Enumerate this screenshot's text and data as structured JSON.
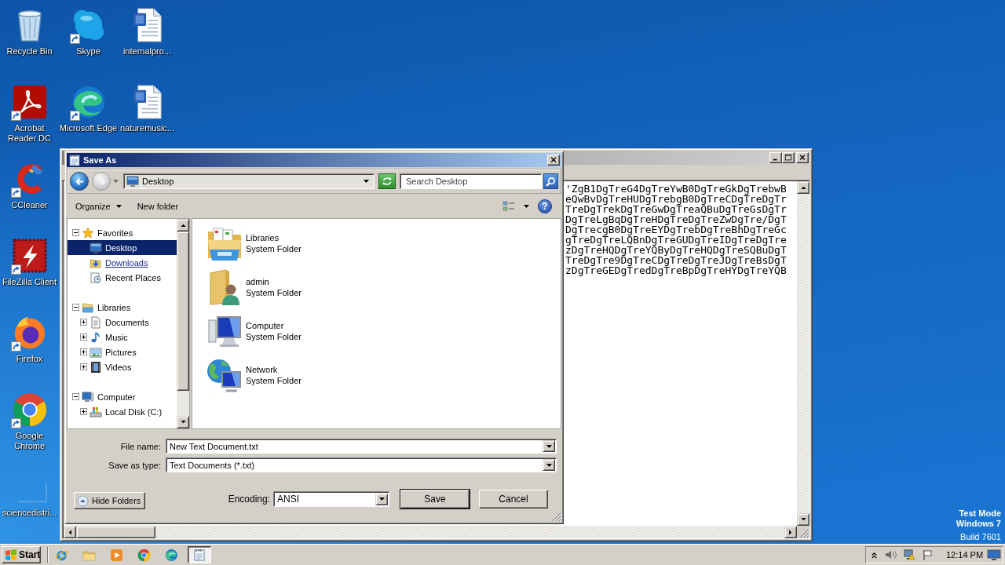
{
  "desktop_icon_columns": [
    [
      {
        "label": "Recycle Bin",
        "kind": "bin",
        "shortcut": false
      },
      {
        "label": "Acrobat Reader DC",
        "kind": "pdf",
        "shortcut": true
      },
      {
        "label": "CCleaner",
        "kind": "cleaner",
        "shortcut": true
      },
      {
        "label": "FileZilla Client",
        "kind": "ftp",
        "shortcut": true
      },
      {
        "label": "Firefox",
        "kind": "firefox",
        "shortcut": true
      },
      {
        "label": "Google Chrome",
        "kind": "chrome",
        "shortcut": true
      },
      {
        "label": "sciencedistri...",
        "kind": "blank",
        "shortcut": false
      }
    ],
    [
      {
        "label": "Skype",
        "kind": "chat",
        "shortcut": true
      },
      {
        "label": "Microsoft Edge",
        "kind": "edge",
        "shortcut": true
      }
    ],
    [
      {
        "label": "internalpro...",
        "kind": "doc",
        "shortcut": false
      },
      {
        "label": "naturemusic...",
        "kind": "doc",
        "shortcut": false
      }
    ]
  ],
  "notepad": {
    "text_lines": [
      "'ZgB1DgTreG4DgTreYwB0DgTreGkDgTrebwB",
      "eQwBvDgTreHUDgTrebgB0DgTreCDgTreDgTr",
      "TreDgTrekDgTreGwDgTreaQBuDgTreGsDgTr",
      "DgTreLgBqDgTreHDgTreDgTreZwDgTre/DgT",
      "DgTrecgB0DgTreEYDgTrebDgTreBhDgTreGc",
      "gTreDgTreLQBnDgTreGUDgTreIDgTreDgTre",
      "zDgTreHQDgTreYQByDgTreHQDgTreSQBuDgT",
      "TreDgTre9DgTreCDgTreDgTreJDgTreBsDgT",
      "zDgTreGEDgTredDgTreBpDgTreHYDgTreYQB"
    ]
  },
  "save_dialog": {
    "title": "Save As",
    "address": "Desktop",
    "search": {
      "placeholder": "Search Desktop"
    },
    "commands": {
      "organize": "Organize",
      "new_folder": "New folder",
      "help": "?"
    },
    "tree": [
      {
        "label": "Favorites",
        "kind": "favorites",
        "expanded": true,
        "selected": false,
        "hovered": false,
        "children": [
          {
            "label": "Desktop",
            "kind": "desktop",
            "selected": true,
            "hovered": false
          },
          {
            "label": "Downloads",
            "kind": "downloads",
            "selected": false,
            "hovered": true
          },
          {
            "label": "Recent Places",
            "kind": "recent",
            "selected": false,
            "hovered": false
          }
        ]
      },
      {
        "label": "Libraries",
        "kind": "libraries",
        "expanded": true,
        "selected": false,
        "hovered": false,
        "children": [
          {
            "label": "Documents",
            "kind": "documents",
            "expanded": false,
            "selected": false,
            "hovered": false
          },
          {
            "label": "Music",
            "kind": "music",
            "expanded": false,
            "selected": false,
            "hovered": false
          },
          {
            "label": "Pictures",
            "kind": "pictures",
            "expanded": false,
            "selected": false,
            "hovered": false
          },
          {
            "label": "Videos",
            "kind": "videos",
            "expanded": false,
            "selected": false,
            "hovered": false
          }
        ]
      },
      {
        "label": "Computer",
        "kind": "computer",
        "expanded": true,
        "selected": false,
        "hovered": false,
        "children": [
          {
            "label": "Local Disk (C:)",
            "kind": "disk",
            "expanded": false,
            "selected": false,
            "hovered": false
          }
        ]
      }
    ],
    "items": [
      {
        "name": "Libraries",
        "type": "System Folder",
        "kind": "library"
      },
      {
        "name": "admin",
        "type": "System Folder",
        "kind": "user"
      },
      {
        "name": "Computer",
        "type": "System Folder",
        "kind": "computer"
      },
      {
        "name": "Network",
        "type": "System Folder",
        "kind": "network"
      }
    ],
    "file_name": {
      "label": "File name:",
      "value": "New Text Document.txt"
    },
    "save_type": {
      "label": "Save as type:",
      "value": "Text Documents (*.txt)"
    },
    "hide_folders": "Hide Folders",
    "encoding": {
      "label": "Encoding:",
      "value": "ANSI"
    },
    "buttons": [
      {
        "label": "Save",
        "default": true
      },
      {
        "label": "Cancel",
        "default": false
      }
    ]
  },
  "taskbar": {
    "start": "Start",
    "windows": [
      {
        "kind": "notepad",
        "active": true
      }
    ],
    "clock": "12:14 PM"
  },
  "test_mode": {
    "mode": "Test Mode",
    "os": "Windows 7",
    "build": "Build 7601"
  }
}
